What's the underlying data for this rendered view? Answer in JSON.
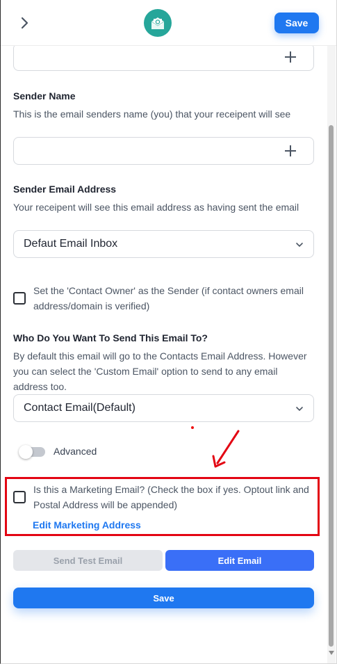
{
  "header": {
    "save_label": "Save",
    "logo_icon": "email-at-icon",
    "back_icon": "chevron-right-icon"
  },
  "sender_name": {
    "label": "Sender Name",
    "help": "This is the email senders name (you) that your receipent will see",
    "value": ""
  },
  "sender_email": {
    "label": "Sender Email Address",
    "help": "Your receipent will see this email address as having sent the email",
    "selected": "Defaut Email Inbox"
  },
  "contact_owner": {
    "label": "Set the 'Contact Owner' as the Sender (if contact owners email address/domain is verified)",
    "checked": false
  },
  "recipient": {
    "label": "Who Do You Want To Send This Email To?",
    "help": "By default this email will go to the Contacts Email Address. However you can select the 'Custom Email' option to send to any email address too.",
    "selected": "Contact Email(Default)"
  },
  "advanced": {
    "label": "Advanced",
    "enabled": false
  },
  "marketing": {
    "label": "Is this a Marketing Email? (Check the box if yes. Optout link and Postal Address will be appended)",
    "checked": false,
    "edit_link": "Edit Marketing Address"
  },
  "actions": {
    "send_test_label": "Send Test Email",
    "edit_email_label": "Edit Email",
    "save_label": "Save"
  },
  "colors": {
    "primary": "#1f78f0",
    "edit_button": "#3a6ff7",
    "highlight": "#e30613",
    "logo": "#26a69a"
  }
}
